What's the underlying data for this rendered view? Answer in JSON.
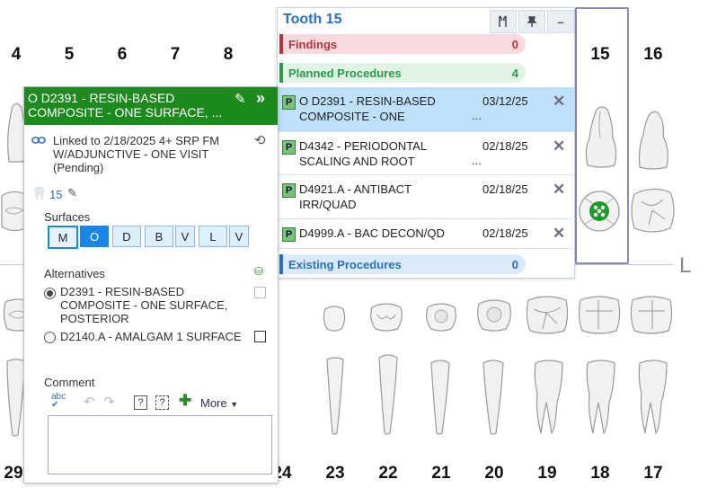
{
  "chart": {
    "upper_numbers": [
      "4",
      "5",
      "6",
      "7",
      "8",
      "15",
      "16"
    ],
    "lower_numbers": [
      "29",
      "24",
      "23",
      "22",
      "21",
      "20",
      "19",
      "18",
      "17"
    ],
    "quadrant_mark": "L"
  },
  "tooth_panel": {
    "title": "Tooth 15",
    "categories": {
      "findings": {
        "label": "Findings",
        "count": "0",
        "color": "#b8343c"
      },
      "planned": {
        "label": "Planned Procedures",
        "count": "4",
        "color": "#2a9a4a"
      },
      "existing": {
        "label": "Existing Procedures",
        "count": "0",
        "color": "#2a6fc0"
      }
    },
    "procedures": [
      {
        "status": "P",
        "line1": "O D2391 - RESIN-BASED",
        "line2": "COMPOSITE - ONE",
        "date": "03/12/25",
        "more": "...",
        "selected": true
      },
      {
        "status": "P",
        "line1": "D4342 - PERIODONTAL",
        "line2": "SCALING AND ROOT",
        "date": "02/18/25",
        "more": "...",
        "selected": false
      },
      {
        "status": "P",
        "line1": "D4921.A - ANTIBACT",
        "line2": "IRR/QUAD",
        "date": "02/18/25",
        "more": "",
        "selected": false
      },
      {
        "status": "P",
        "line1": "D4999.A - BAC DECON/QD",
        "line2": "",
        "date": "02/18/25",
        "more": "",
        "selected": false
      }
    ]
  },
  "detail": {
    "title_line1": "O D2391 - RESIN-BASED",
    "title_line2": "COMPOSITE - ONE SURFACE, ...",
    "linked_line1": "Linked to 2/18/2025 4+ SRP FM",
    "linked_line2": "W/ADJUNCTIVE - ONE VISIT",
    "linked_line3": "(Pending)",
    "tooth": "15",
    "surfaces_label": "Surfaces",
    "surfaces": [
      "M",
      "O",
      "D",
      "B",
      "V",
      "L",
      "V"
    ],
    "alternatives_label": "Alternatives",
    "alt1_line1": "D2391 - RESIN-BASED",
    "alt1_line2": "COMPOSITE - ONE SURFACE,",
    "alt1_line3": "POSTERIOR",
    "alt2": "D2140.A - AMALGAM 1 SURFACE",
    "comment_label": "Comment",
    "more_label": "More"
  }
}
